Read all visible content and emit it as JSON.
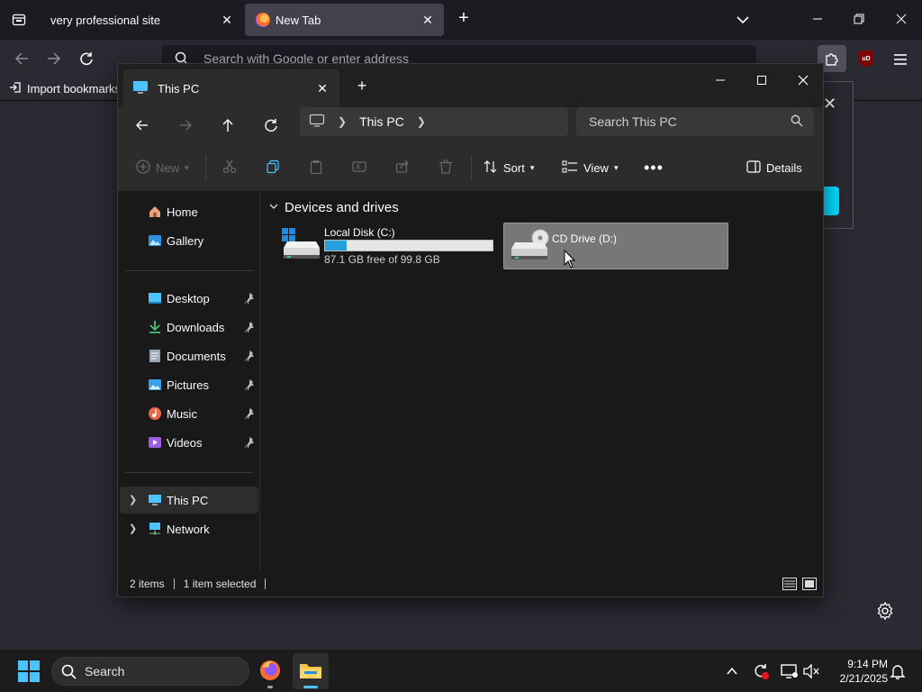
{
  "browser": {
    "tabs": [
      {
        "title": "very professional site",
        "active": false
      },
      {
        "title": "New Tab",
        "active": true
      }
    ],
    "urlbar_placeholder": "Search with Google or enter address",
    "bookmarks": {
      "import_label": "Import bookmarks"
    },
    "ublock_label": "uD"
  },
  "explorer": {
    "tab_title": "This PC",
    "breadcrumb": [
      "This PC"
    ],
    "search_placeholder": "Search This PC",
    "toolbar": {
      "new_label": "New",
      "sort_label": "Sort",
      "view_label": "View",
      "details_label": "Details"
    },
    "nav": {
      "quick": [
        {
          "label": "Home"
        },
        {
          "label": "Gallery"
        }
      ],
      "pinned": [
        {
          "label": "Desktop"
        },
        {
          "label": "Downloads"
        },
        {
          "label": "Documents"
        },
        {
          "label": "Pictures"
        },
        {
          "label": "Music"
        },
        {
          "label": "Videos"
        }
      ],
      "tree": [
        {
          "label": "This PC",
          "selected": true
        },
        {
          "label": "Network",
          "selected": false
        }
      ]
    },
    "group_header": "Devices and drives",
    "drives": [
      {
        "name": "Local Disk (C:)",
        "free_text": "87.1 GB free of 99.8 GB",
        "used_fraction": 0.127
      },
      {
        "name": "CD Drive (D:)",
        "selected": true
      }
    ],
    "status": {
      "items": "2 items",
      "selected": "1 item selected"
    }
  },
  "taskbar": {
    "search_label": "Search",
    "time": "9:14 PM",
    "date": "2/21/2025"
  },
  "colors": {
    "accent": "#26a0da",
    "firefox_bg": "#2b2a33",
    "explorer_bg": "#191919"
  }
}
